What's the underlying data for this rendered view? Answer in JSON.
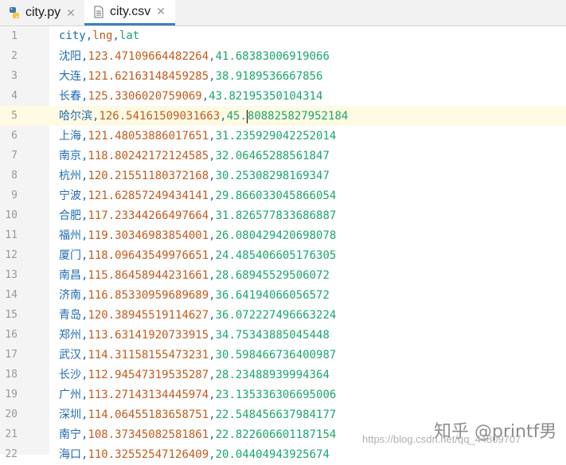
{
  "tabs": [
    {
      "label": "city.py",
      "icon": "python-file-icon"
    },
    {
      "label": "city.csv",
      "icon": "text-file-icon",
      "active": true
    }
  ],
  "header_cols": [
    "city",
    "lng",
    "lat"
  ],
  "rows": [
    {
      "n": "1"
    },
    {
      "n": "2",
      "city": "沈阳",
      "lng": "123.47109664482264",
      "lat": "41.68383006919066"
    },
    {
      "n": "3",
      "city": "大连",
      "lng": "121.62163148459285",
      "lat": "38.9189536667856"
    },
    {
      "n": "4",
      "city": "长春",
      "lng": "125.3306020759069",
      "lat": "43.82195350104314"
    },
    {
      "n": "5",
      "city": "哈尔滨",
      "lng": "126.54161509031663",
      "lat": "45.808825827952184",
      "current": true
    },
    {
      "n": "6",
      "city": "上海",
      "lng": "121.48053886017651",
      "lat": "31.235929042252014"
    },
    {
      "n": "7",
      "city": "南京",
      "lng": "118.80242172124585",
      "lat": "32.06465288561847"
    },
    {
      "n": "8",
      "city": "杭州",
      "lng": "120.21551180372168",
      "lat": "30.25308298169347"
    },
    {
      "n": "9",
      "city": "宁波",
      "lng": "121.62857249434141",
      "lat": "29.866033045866054"
    },
    {
      "n": "10",
      "city": "合肥",
      "lng": "117.23344266497664",
      "lat": "31.826577833686887"
    },
    {
      "n": "11",
      "city": "福州",
      "lng": "119.30346983854001",
      "lat": "26.080429420698078"
    },
    {
      "n": "12",
      "city": "厦门",
      "lng": "118.09643549976651",
      "lat": "24.485406605176305"
    },
    {
      "n": "13",
      "city": "南昌",
      "lng": "115.86458944231661",
      "lat": "28.68945529506072"
    },
    {
      "n": "14",
      "city": "济南",
      "lng": "116.85330959689689",
      "lat": "36.64194066056572"
    },
    {
      "n": "15",
      "city": "青岛",
      "lng": "120.38945519114627",
      "lat": "36.072227496663224"
    },
    {
      "n": "16",
      "city": "郑州",
      "lng": "113.63141920733915",
      "lat": "34.75343885045448"
    },
    {
      "n": "17",
      "city": "武汉",
      "lng": "114.31158155473231",
      "lat": "30.598466736400987"
    },
    {
      "n": "18",
      "city": "长沙",
      "lng": "112.94547319535287",
      "lat": "28.23488939994364"
    },
    {
      "n": "19",
      "city": "广州",
      "lng": "113.27143134445974",
      "lat": "23.135336306695006"
    },
    {
      "n": "20",
      "city": "深圳",
      "lng": "114.06455183658751",
      "lat": "22.548456637984177"
    },
    {
      "n": "21",
      "city": "南宁",
      "lng": "108.37345082581861",
      "lat": "22.822606601187154"
    },
    {
      "n": "22",
      "city": "海口",
      "lng": "110.32552547126409",
      "lat": "20.04404943925674"
    }
  ],
  "watermark": {
    "brand": "知乎 @printf男",
    "url": "https://blog.csdn.net/qq_44809707"
  }
}
